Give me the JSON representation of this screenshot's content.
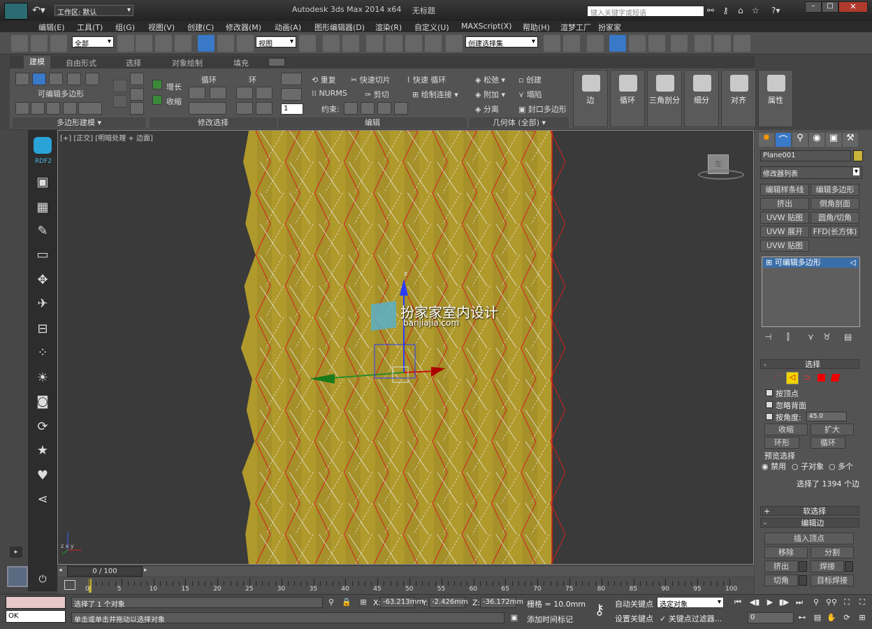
{
  "title_bar": {
    "workspace_label": "工作区: 默认",
    "app_title": "Autodesk 3ds Max  2014 x64",
    "doc_title": "无标题",
    "search_placeholder": "键入关键字或短语"
  },
  "menu": [
    "编辑(E)",
    "工具(T)",
    "组(G)",
    "视图(V)",
    "创建(C)",
    "修改器(M)",
    "动画(A)",
    "图形编辑器(D)",
    "渲染(R)",
    "自定义(U)",
    "MAXScript(X)",
    "帮助(H)",
    "渲梦工厂",
    "扮家家"
  ],
  "toolbar": {
    "selection_filter": "全部",
    "ref_coord": "视图",
    "named_selection": "创建选择集"
  },
  "ribbon": {
    "tabs": [
      "建模",
      "自由形式",
      "选择",
      "对象绘制",
      "填充"
    ],
    "active_tab": "建模",
    "polygon_modeling": {
      "label": "可编辑多边形",
      "footer": "多边形建模 ▾"
    },
    "modify_selection": {
      "grow": "增长",
      "shrink": "收缩",
      "loop": "循环",
      "ring": "环",
      "footer": "修改选择"
    },
    "edit": {
      "repeat": "重复",
      "quickslice": "快速切片",
      "quickloop": "快速 循环",
      "nurms": "NURMS",
      "cut": "剪切",
      "paintconnect": "绘制连接",
      "constraints": "约束:",
      "spinner": "1",
      "footer": "编辑"
    },
    "geometry": {
      "relax": "松弛",
      "create": "创建",
      "attach": "附加",
      "collapse": "塌陷",
      "detach": "分离",
      "cap": "封口多边形",
      "footer": "几何体 (全部)"
    },
    "big_buttons": [
      "边",
      "循环",
      "三角剖分",
      "细分",
      "对齐",
      "属性"
    ]
  },
  "viewport": {
    "label_plus": "[+]",
    "label_view": "[正交]",
    "label_shading": "[明暗处理 + 边面]",
    "watermark_cn": "扮家家室内设计",
    "watermark_url": "banjiajia.com",
    "viewcube_text": "左",
    "gizmo_axis_z": "z",
    "mini_axis_label": "z  x  y"
  },
  "sidebar": {
    "brand": "RDF2"
  },
  "command_panel": {
    "object_name": "Plane001",
    "object_color": "#c8b43a",
    "modifier_list": "修改器列表",
    "modifier_buttons": [
      "编辑样条线",
      "编辑多边形",
      "挤出",
      "倒角剖面",
      "UVW 贴图",
      "圆角/切角",
      "UVW 展开",
      "FFD(长方体)",
      "UVW 贴图"
    ],
    "stack_item": "可编辑多边形",
    "selection": {
      "header": "选择",
      "by_vertex": "按顶点",
      "ignore_backfacing": "忽略背面",
      "by_angle": "按角度:",
      "angle_value": "45.0",
      "shrink": "收缩",
      "grow": "扩大",
      "ring": "环形",
      "loop": "循环",
      "preview_label": "预览选择",
      "preview_disabled": "禁用",
      "preview_subobject": "子对象",
      "preview_multi": "多个",
      "status": "选择了 1394 个边"
    },
    "soft_selection": "软选择",
    "edit_edges": {
      "header": "编辑边",
      "insert_vertex": "插入顶点",
      "remove": "移除",
      "split": "分割",
      "extrude": "挤出",
      "weld": "焊接",
      "chamfer": "切角",
      "target_weld": "目标焊接"
    }
  },
  "timeline": {
    "frame_display": "0 / 100",
    "ticks": [
      "0",
      "5",
      "10",
      "15",
      "20",
      "25",
      "30",
      "35",
      "40",
      "45",
      "50",
      "55",
      "60",
      "65",
      "70",
      "75",
      "80",
      "85",
      "90",
      "95",
      "100"
    ]
  },
  "status": {
    "listener_output": "OK",
    "selected": "选择了 1 个对象",
    "prompt": "单击或单击并拖动以选择对象",
    "x_label": "X:",
    "x": "-63.213mm",
    "y_label": "Y:",
    "y": "-2.426mm",
    "z_label": "Z:",
    "z": "-36.172mm",
    "grid": "栅格 = 10.0mm",
    "add_time_tag": "添加时间标记",
    "auto_key": "自动关键点",
    "selected_objects": "选定对象",
    "set_key": "设置关键点",
    "key_filters": "关键点过滤器...",
    "frame_spinner": "0"
  },
  "colors": {
    "mesh_fill": "#b09a2c",
    "edge_red": "#d42020",
    "edge_white": "#f0f0f0",
    "accent_blue": "#3a6ea8"
  }
}
